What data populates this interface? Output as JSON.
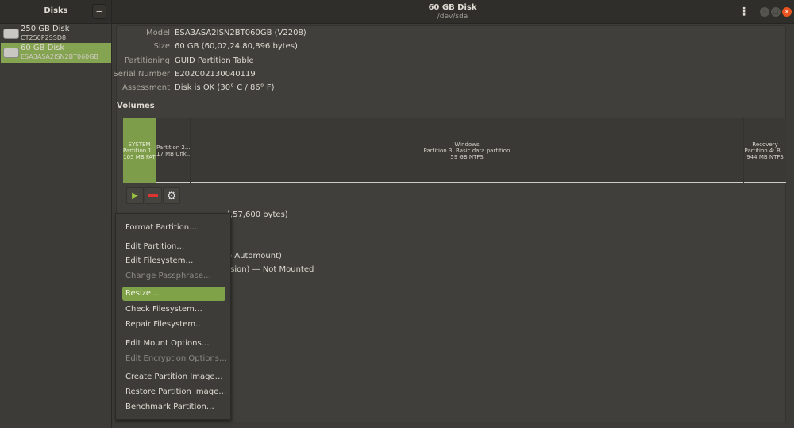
{
  "sidebar": {
    "title": "Disks",
    "menu_icon": "hamburger-icon",
    "disks": [
      {
        "name": "250 GB Disk",
        "model": "CT250P2SSD8",
        "selected": false
      },
      {
        "name": "60 GB Disk",
        "model": "ESA3ASA2ISN2BT060GB",
        "selected": true
      }
    ]
  },
  "header": {
    "title": "60 GB Disk",
    "subtitle": "/dev/sda",
    "menu_icon": "kebab-icon"
  },
  "window_controls": [
    "minimize",
    "maximize",
    "close"
  ],
  "colors": {
    "accent": "#7fa147",
    "close": "#e95420"
  },
  "disk_info": [
    {
      "label": "Model",
      "value": "ESA3ASA2ISN2BT060GB (V2208)"
    },
    {
      "label": "Size",
      "value": "60 GB (60,02,24,80,896 bytes)"
    },
    {
      "label": "Partitioning",
      "value": "GUID Partition Table"
    },
    {
      "label": "Serial Number",
      "value": "E202002130040119"
    },
    {
      "label": "Assessment",
      "value": "Disk is OK (30° C / 86° F)"
    }
  ],
  "volumes": {
    "title": "Volumes",
    "partitions": [
      {
        "l1": "SYSTEM",
        "l2": "Partition 1...",
        "l3": "105 MB FAT",
        "selected": true
      },
      {
        "l1": "",
        "l2": "Partition 2...",
        "l3": "17 MB Unk..."
      },
      {
        "l1": "Windows",
        "l2": "Partition 3: Basic data partition",
        "l3": "59 GB NTFS"
      },
      {
        "l1": "Recovery",
        "l2": "Partition 4: B...",
        "l3": "944 MB NTFS"
      }
    ]
  },
  "details_partial": [
    "),57,600 bytes)",
    "o Automount)",
    "rsion) — Not Mounted"
  ],
  "context_menu": [
    {
      "label": "Format Partition…"
    },
    {
      "label": "Edit Partition…"
    },
    {
      "label": "Edit Filesystem…"
    },
    {
      "label": "Change Passphrase…",
      "disabled": true
    },
    {
      "label": "Resize…",
      "highlighted": true
    },
    {
      "label": "Check Filesystem…"
    },
    {
      "label": "Repair Filesystem…"
    },
    {
      "label": "Edit Mount Options…"
    },
    {
      "label": "Edit Encryption Options…",
      "disabled": true
    },
    {
      "label": "Create Partition Image…"
    },
    {
      "label": "Restore Partition Image…"
    },
    {
      "label": "Benchmark Partition…"
    }
  ]
}
